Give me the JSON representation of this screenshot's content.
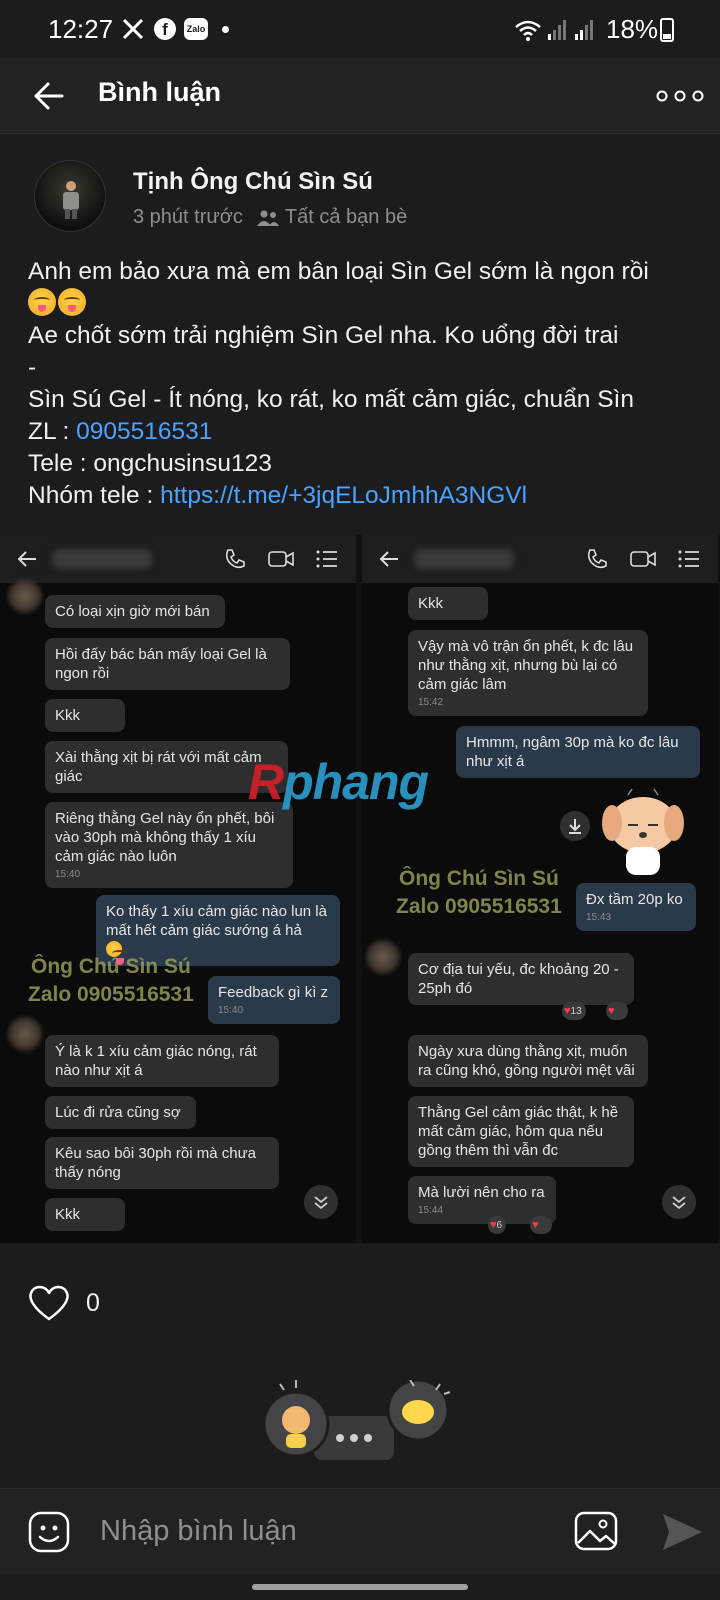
{
  "status_bar": {
    "time": "12:27",
    "zalo_label": "Zalo",
    "battery": "18%",
    "icons": [
      "x-icon",
      "facebook-icon",
      "zalo-icon",
      "wifi-icon",
      "signal-icon",
      "battery-icon"
    ]
  },
  "header": {
    "title": "Bình luận"
  },
  "post": {
    "author": "Tịnh Ông Chú Sìn Sú",
    "time_ago": "3 phút trước",
    "audience": "Tất cả bạn bè",
    "lines": {
      "l1": "Anh em bảo xưa mà em bân loại Sìn Gel sớm là ngon rồi",
      "l3": "Ae chốt sớm trải nghiệm Sìn Gel nha. Ko uổng đời trai",
      "l4": "-",
      "l5": "Sìn Sú Gel - Ít nóng, ko rát, ko mất cảm giác, chuẩn Sìn",
      "zl_prefix": "ZL : ",
      "zl_phone": "0905516531",
      "tele": "Tele : ongchusinsu123",
      "group_prefix": "Nhóm tele : ",
      "group_link": "https://t.me/+3jqELoJmhhA3NGVl"
    },
    "likes": "0"
  },
  "image": {
    "left": [
      {
        "text": "Có loại xịn giờ mới bán"
      },
      {
        "text": "Hồi đấy bác bán mấy loại Gel là ngon rồi"
      },
      {
        "text": "Kkk"
      },
      {
        "text": "Xài thằng xịt bị rát với mất cảm giác"
      },
      {
        "text": "Riêng thằng Gel này ổn phết, bôi vào 30ph mà không thấy 1 xíu cảm giác nào luôn",
        "time": "15:40"
      },
      {
        "text": "Ko thấy 1 xíu cảm giác nào lun là mất hết cảm giác sướng á hả"
      },
      {
        "text": "Feedback gì kì z",
        "time": "15:40"
      },
      {
        "text": "Ý là k 1 xíu cảm giác nóng, rát nào như xịt á"
      },
      {
        "text": "Lúc đi rửa cũng sợ"
      },
      {
        "text": "Kêu sao bôi 30ph rồi mà chưa thấy nóng"
      },
      {
        "text": "Kkk"
      }
    ],
    "right": [
      {
        "text": "Kkk"
      },
      {
        "text": "Vậy mà vô trận ổn phết, k đc lâu như thằng xịt, nhưng bù lại có cảm giác lâm",
        "time": "15:42"
      },
      {
        "text": "Hmmm, ngâm 30p mà ko đc lâu như xịt á"
      },
      {
        "text": "Đx tầm 20p ko",
        "time": "15:43"
      },
      {
        "text": "Cơ địa tui yếu, đc khoảng 20 - 25ph đó"
      },
      {
        "text": "Ngày xưa dùng thằng xịt, muốn ra cũng khó, gồng người mệt vãi"
      },
      {
        "text": "Thằng Gel cảm giác thật, k hề mất cảm giác, hôm qua nếu gồng thêm thì vẫn đc"
      },
      {
        "text": "Mà lười nên cho ra",
        "time": "15:44"
      }
    ],
    "reactions": {
      "r1": "13",
      "r2": "6"
    },
    "watermark_left": {
      "line1": "Ông Chú Sìn Sú",
      "line2": "Zalo 0905516531"
    },
    "watermark_right": {
      "line1": "Ông Chú Sìn Sú",
      "line2": "Zalo 0905516531"
    },
    "brand_a": "R",
    "brand_b": "phang"
  },
  "comment_bar": {
    "placeholder": "Nhập bình luận"
  },
  "colors": {
    "link": "#4aa3ff",
    "background": "#1c1c1e",
    "bubble": "#2e2e30",
    "bubble_mine": "#2b3a4a"
  }
}
